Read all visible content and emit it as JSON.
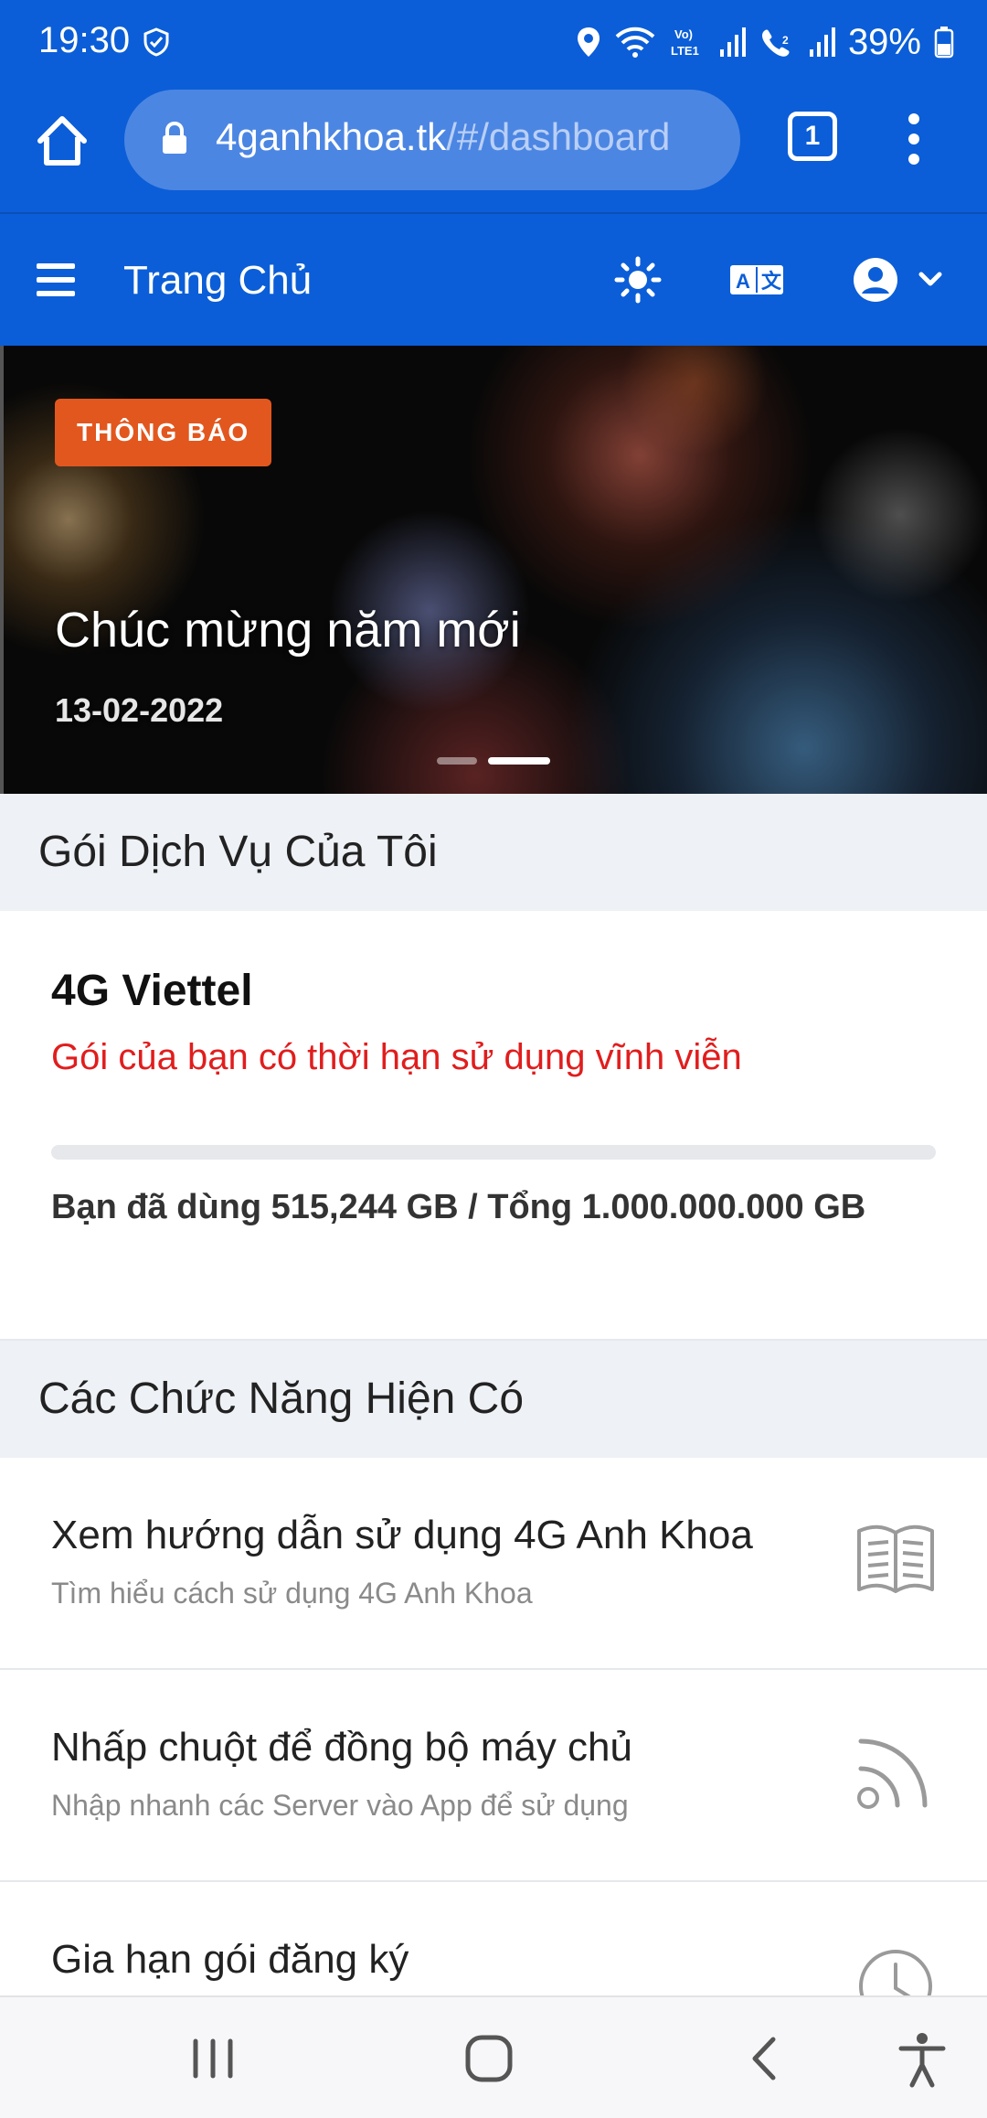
{
  "status_bar": {
    "time": "19:30",
    "battery": "39%",
    "icons": [
      "shield-check-icon",
      "location-icon",
      "wifi-icon",
      "volte-lte-icon",
      "signal-icon",
      "wifi-calling-icon",
      "signal-icon",
      "battery-icon"
    ]
  },
  "browser": {
    "url_domain": "4ganhkhoa.tk",
    "url_path": "/#/dashboard",
    "tab_count": "1"
  },
  "header": {
    "title": "Trang Chủ"
  },
  "banner": {
    "badge": "THÔNG BÁO",
    "title": "Chúc mừng năm mới",
    "date": "13-02-2022",
    "slide_count": 2,
    "active_slide": 2
  },
  "my_plan": {
    "section_title": "Gói Dịch Vụ Của Tôi",
    "plan_name": "4G Viettel",
    "validity_note": "Gói của bạn có thời hạn sử dụng vĩnh viễn",
    "usage_text": "Bạn đã dùng 515,244 GB / Tổng 1.000.000.000 GB",
    "usage_fraction": 5e-07
  },
  "features": {
    "section_title": "Các Chức Năng Hiện Có",
    "items": [
      {
        "title": "Xem hướng dẫn sử dụng 4G Anh Khoa",
        "subtitle": "Tìm hiểu cách sử dụng 4G Anh Khoa",
        "icon": "book-icon"
      },
      {
        "title": "Nhấp chuột để đồng bộ máy chủ",
        "subtitle": "Nhập nhanh các Server vào App để sử dụng",
        "icon": "rss-icon"
      },
      {
        "title": "Gia hạn gói đăng ký",
        "subtitle": "",
        "icon": "clock-icon"
      }
    ]
  },
  "colors": {
    "primary": "#0b5ed7",
    "badge": "#e2571e",
    "warning_text": "#e11d1d"
  }
}
